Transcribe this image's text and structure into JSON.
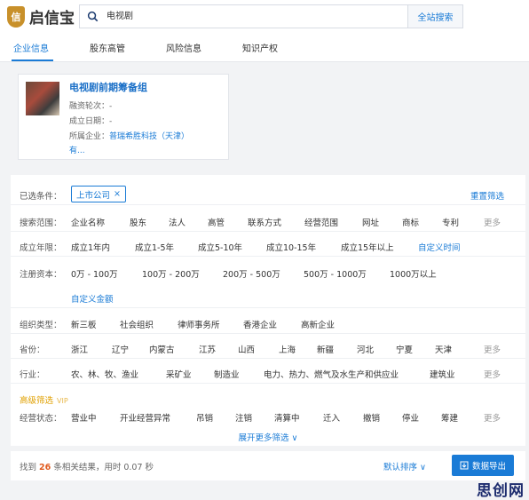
{
  "app": {
    "name": "启信宝",
    "logo_mark": "信"
  },
  "search": {
    "value": "电视剧",
    "button": "全站搜索"
  },
  "tabs": [
    "企业信息",
    "股东高管",
    "风险信息",
    "知识产权"
  ],
  "card": {
    "title": "电视剧前期筹备组",
    "funding": "融资轮次：-",
    "founded": "成立日期：-",
    "company_label": "所属企业：",
    "company_link": "普瑞希胜科技（天津）",
    "more": "有..."
  },
  "filters": {
    "selected_label": "已选条件：",
    "selected_chip": "上市公司",
    "chip_close": "×",
    "reset": "重置筛选",
    "more": "更多",
    "rows": {
      "scope": {
        "label": "搜索范围：",
        "options": [
          "企业名称",
          "股东",
          "法人",
          "高管",
          "联系方式",
          "经营范围",
          "网址",
          "商标",
          "专利"
        ]
      },
      "age": {
        "label": "成立年限：",
        "options": [
          "成立1年内",
          "成立1-5年",
          "成立5-10年",
          "成立10-15年",
          "成立15年以上",
          "自定义时间"
        ]
      },
      "capital": {
        "label": "注册资本：",
        "options": [
          "0万 - 100万",
          "100万 - 200万",
          "200万 - 500万",
          "500万 - 1000万",
          "1000万以上"
        ],
        "custom": "自定义金额"
      },
      "org": {
        "label": "组织类型：",
        "options": [
          "新三板",
          "社会组织",
          "律师事务所",
          "香港企业",
          "高新企业"
        ]
      },
      "province": {
        "label": "省份：",
        "options": [
          "浙江",
          "辽宁",
          "内蒙古",
          "江苏",
          "山西",
          "上海",
          "新疆",
          "河北",
          "宁夏",
          "天津"
        ]
      },
      "industry": {
        "label": "行业：",
        "options": [
          "农、林、牧、渔业",
          "采矿业",
          "制造业",
          "电力、热力、燃气及水生产和供应业",
          "建筑业"
        ]
      },
      "advanced": {
        "label": "高级筛选",
        "badge": "VIP"
      },
      "status": {
        "label": "经营状态：",
        "options": [
          "营业中",
          "开业经营异常",
          "吊销",
          "注销",
          "清算中",
          "迁入",
          "撤销",
          "停业",
          "筹建"
        ]
      }
    },
    "expand": "展开更多筛选 ∨"
  },
  "results": {
    "prefix": "找到",
    "count": "26",
    "suffix": "条相关结果，用时 0.07 秒",
    "sort": "默认排序 ∨",
    "export": "数据导出"
  },
  "watermark": "思创网",
  "colors": {
    "accent": "#1a7bd6",
    "count": "#e05a1e",
    "vip": "#e0a000"
  }
}
